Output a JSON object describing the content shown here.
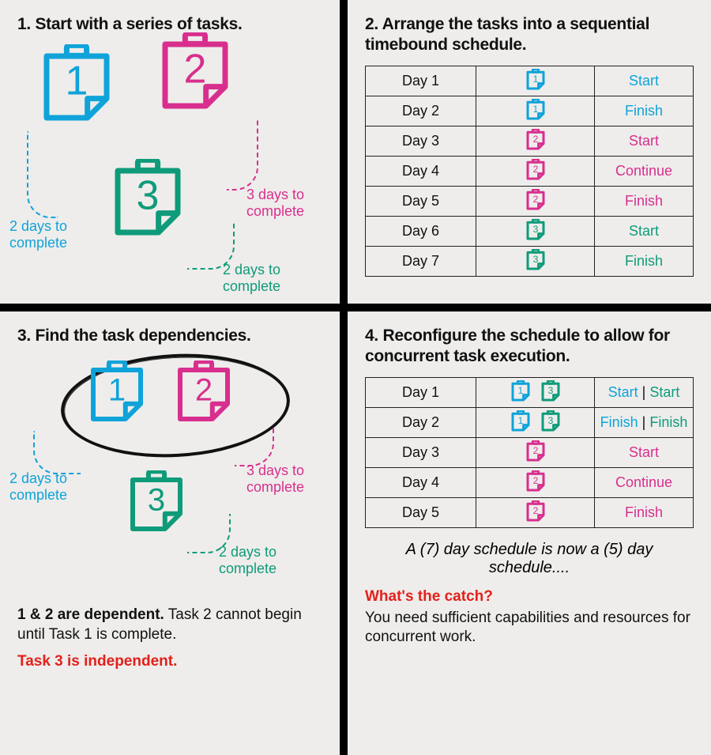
{
  "colors": {
    "blue": "#0FA3D9",
    "pink": "#D82F8E",
    "green": "#0F9B7A",
    "red": "#E3201B"
  },
  "tasks": {
    "1": {
      "number": "1",
      "color": "blue",
      "duration_label": "2 days to complete",
      "duration_days": 2
    },
    "2": {
      "number": "2",
      "color": "pink",
      "duration_label": "3 days to complete",
      "duration_days": 3
    },
    "3": {
      "number": "3",
      "color": "green",
      "duration_label": "2 days to complete",
      "duration_days": 2
    }
  },
  "panel1": {
    "title": "1. Start with a series of tasks."
  },
  "panel2": {
    "title": "2. Arrange the tasks into a sequential timebound schedule.",
    "rows": [
      {
        "day": "Day 1",
        "icons": [
          {
            "task": "1"
          }
        ],
        "status_parts": [
          {
            "text": "Start",
            "color": "blue"
          }
        ]
      },
      {
        "day": "Day 2",
        "icons": [
          {
            "task": "1"
          }
        ],
        "status_parts": [
          {
            "text": "Finish",
            "color": "blue"
          }
        ]
      },
      {
        "day": "Day 3",
        "icons": [
          {
            "task": "2"
          }
        ],
        "status_parts": [
          {
            "text": "Start",
            "color": "pink"
          }
        ]
      },
      {
        "day": "Day 4",
        "icons": [
          {
            "task": "2"
          }
        ],
        "status_parts": [
          {
            "text": "Continue",
            "color": "pink"
          }
        ]
      },
      {
        "day": "Day 5",
        "icons": [
          {
            "task": "2"
          }
        ],
        "status_parts": [
          {
            "text": "Finish",
            "color": "pink"
          }
        ]
      },
      {
        "day": "Day 6",
        "icons": [
          {
            "task": "3"
          }
        ],
        "status_parts": [
          {
            "text": "Start",
            "color": "green"
          }
        ]
      },
      {
        "day": "Day 7",
        "icons": [
          {
            "task": "3"
          }
        ],
        "status_parts": [
          {
            "text": "Finish",
            "color": "green"
          }
        ]
      }
    ]
  },
  "panel3": {
    "title": "3. Find the task dependencies.",
    "dep_line_bold": "1 & 2 are dependent.",
    "dep_line_rest": "Task 2 cannot begin until Task 1 is complete.",
    "independent_line": "Task 3 is independent."
  },
  "panel4": {
    "title": "4. Reconfigure the schedule to allow for concurrent task execution.",
    "rows": [
      {
        "day": "Day 1",
        "icons": [
          {
            "task": "1"
          },
          {
            "task": "3"
          }
        ],
        "status_parts": [
          {
            "text": "Start",
            "color": "blue"
          },
          {
            "text": "Start",
            "color": "green"
          }
        ]
      },
      {
        "day": "Day 2",
        "icons": [
          {
            "task": "1"
          },
          {
            "task": "3"
          }
        ],
        "status_parts": [
          {
            "text": "Finish",
            "color": "blue"
          },
          {
            "text": "Finish",
            "color": "green"
          }
        ]
      },
      {
        "day": "Day 3",
        "icons": [
          {
            "task": "2"
          }
        ],
        "status_parts": [
          {
            "text": "Start",
            "color": "pink"
          }
        ]
      },
      {
        "day": "Day 4",
        "icons": [
          {
            "task": "2"
          }
        ],
        "status_parts": [
          {
            "text": "Continue",
            "color": "pink"
          }
        ]
      },
      {
        "day": "Day 5",
        "icons": [
          {
            "task": "2"
          }
        ],
        "status_parts": [
          {
            "text": "Finish",
            "color": "pink"
          }
        ]
      }
    ],
    "summary": "A (7) day schedule is now a (5) day schedule....",
    "catch_title": "What's the catch?",
    "catch_body": "You need sufficient capabilities and resources for concurrent work."
  }
}
